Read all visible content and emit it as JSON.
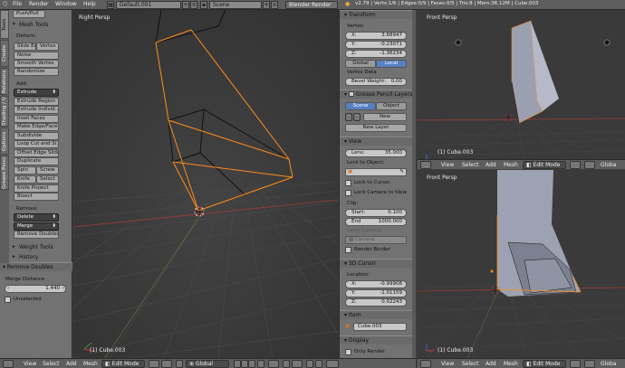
{
  "topbar": {
    "menus": [
      "File",
      "Render",
      "Window",
      "Help"
    ],
    "screen_layout": "Default.001",
    "scene": "Scene",
    "render_engine": "Blender Render",
    "stats": "v2.79 | Verts:1/6 | Edges:0/9 | Faces:0/5 | Tris:8 | Mem:36.12M | Cube.003"
  },
  "shelf": {
    "tabs": [
      "Tools",
      "Create",
      "Relations",
      "Shading / UVs",
      "Options",
      "Grease Pencil"
    ],
    "top_button": "Push/Pull",
    "section_title": "Mesh Tools",
    "deform_label": "Deform:",
    "deform_buttons": [
      "Slide Ed",
      "Vertex",
      "Noise",
      "Smooth Vertex",
      "Randomize"
    ],
    "add_label": "Add:",
    "extrude_dropdown": "Extrude",
    "add_buttons": [
      "Extrude Region",
      "Extrude Individ...",
      "Inset Faces",
      "Make Edge/Face",
      "Subdivide",
      "Loop Cut and Sl...",
      "Offset Edge Slide",
      "Duplicate"
    ],
    "row_buttons": [
      [
        "Spin",
        "Screw"
      ],
      [
        "Knife",
        "Select"
      ]
    ],
    "more_buttons": [
      "Knife Project",
      "Bisect"
    ],
    "remove_label": "Remove:",
    "delete_dropdown": "Delete",
    "merge_dropdown": "Merge",
    "remove_doubles_button": "Remove Doubles",
    "weight_tools": "Weight Tools",
    "history": "History",
    "operator_title": "Remove Doubles",
    "merge_distance_label": "Merge Distance",
    "merge_distance_value": "1.440",
    "unselected_label": "Unselected"
  },
  "viewport_main": {
    "label": "Right Persp",
    "object_label": "(1) Cube.003"
  },
  "bottom_bar": {
    "menus": [
      "View",
      "Select",
      "Add",
      "Mesh"
    ],
    "mode": "Edit Mode",
    "pivot": "Global"
  },
  "npanel": {
    "transform_title": "Transform",
    "vertex_label": "Vertex:",
    "x_label": "X:",
    "x_value": "3.68947",
    "y_label": "Y:",
    "y_value": "-0.23071",
    "z_label": "Z:",
    "z_value": "-1.36234",
    "global_btn": "Global",
    "local_btn": "Local",
    "vertex_data": "Vertex Data",
    "bevel_weight_label": "Bevel Weight:",
    "bevel_weight_value": "0.00",
    "gp_title": "Grease Pencil Layers",
    "scene_btn": "Scene",
    "object_btn": "Object",
    "new_btn": "New",
    "new_layer_btn": "New Layer",
    "view_title": "View",
    "lens_label": "Lens:",
    "lens_value": "35.000",
    "lock_object_label": "Lock to Object:",
    "lock_cursor": "Lock to Cursor",
    "lock_camera": "Lock Camera to View",
    "clip_label": "Clip:",
    "start_label": "Start:",
    "start_value": "0.100",
    "end_label": "End",
    "end_value": "1000.000",
    "local_camera_label": "Local Camera:",
    "camera_dd": "Camera",
    "render_border": "Render Border",
    "cursor_title": "3D Cursor",
    "location_label": "Location:",
    "cx_label": "X:",
    "cx_value": "-0.99908",
    "cy_label": "Y:",
    "cy_value": "-1.01159",
    "cz_label": "Z:",
    "cz_value": "0.02243",
    "item_title": "Item",
    "item_name": "Cube.003",
    "display_title": "Display",
    "only_render": "Only Render"
  },
  "right_top": {
    "label": "Front Persp",
    "object_label": "(1) Cube.003"
  },
  "right_bottom": {
    "label": "Front Persp",
    "object_label": "(1) Cube.003"
  },
  "right_bars": {
    "menus": [
      "View",
      "Select",
      "Add",
      "Mesh"
    ],
    "mode": "Edit Mode",
    "pivot": "Globa"
  },
  "colors": {
    "selection_orange": "#ff8c1a",
    "accent_blue": "#5680c2",
    "grid_red": "#9b3b3b",
    "grid_green": "#5c8a3a"
  }
}
